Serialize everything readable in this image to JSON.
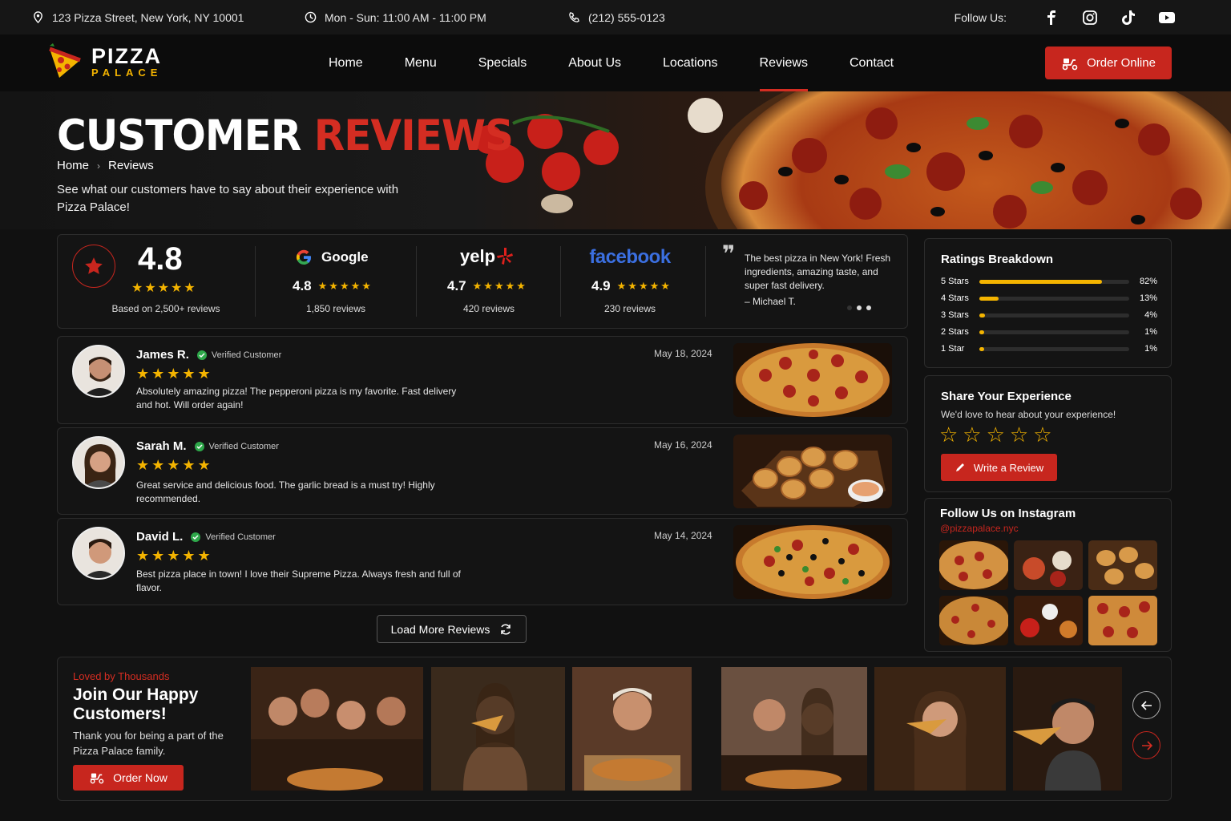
{
  "topbar": {
    "address": "123 Pizza Street, New York, NY 10001",
    "hours": "Mon - Sun: 11:00 AM - 11:00 PM",
    "phone": "(212) 555-0123",
    "follow_label": "Follow Us:",
    "social_icons": [
      "facebook-icon",
      "instagram-icon",
      "tiktok-icon",
      "youtube-icon"
    ]
  },
  "brand": {
    "name_top": "PIZZA",
    "name_bottom": "PALACE"
  },
  "nav": {
    "items": [
      "Home",
      "Menu",
      "Specials",
      "About Us",
      "Locations",
      "Reviews",
      "Contact"
    ],
    "active": "Reviews",
    "order_button": "Order Online"
  },
  "hero": {
    "title_1": "CUSTOMER",
    "title_2": "REVIEWS",
    "breadcrumb_home": "Home",
    "breadcrumb_current": "Reviews",
    "description": "See what our customers have to say about their experience with Pizza Palace!"
  },
  "summary": {
    "overall": "4.8",
    "overall_stars": "★★★★★",
    "overall_sub": "Based on 2,500+ reviews",
    "platforms": [
      {
        "name": "Google",
        "rating": "4.8",
        "stars": "★★★★★",
        "count": "1,850 reviews"
      },
      {
        "name": "yelp",
        "rating": "4.7",
        "stars": "★★★★★",
        "count": "420 reviews"
      },
      {
        "name": "facebook",
        "rating": "4.9",
        "stars": "★★★★★",
        "count": "230 reviews"
      }
    ],
    "quote": "The best pizza in New York! Fresh ingredients, amazing taste, and super fast delivery.",
    "quote_author": "– Michael T."
  },
  "reviews": [
    {
      "name": "James R.",
      "verified": "Verified Customer",
      "date": "May 18, 2024",
      "stars": "★★★★★",
      "text": "Absolutely amazing pizza! The pepperoni pizza is my favorite. Fast delivery and hot. Will order again!"
    },
    {
      "name": "Sarah M.",
      "verified": "Verified Customer",
      "date": "May 16, 2024",
      "stars": "★★★★★",
      "text": "Great service and delicious food. The garlic bread is a must try! Highly recommended."
    },
    {
      "name": "David L.",
      "verified": "Verified Customer",
      "date": "May 14, 2024",
      "stars": "★★★★★",
      "text": "Best pizza place in town! I love their Supreme Pizza. Always fresh and full of flavor."
    }
  ],
  "load_more": "Load More Reviews",
  "breakdown": {
    "title": "Ratings Breakdown",
    "rows": [
      {
        "label": "5 Stars",
        "pct": "82%",
        "value": 0.82
      },
      {
        "label": "4 Stars",
        "pct": "13%",
        "value": 0.13
      },
      {
        "label": "3 Stars",
        "pct": "4%",
        "value": 0.04
      },
      {
        "label": "2 Stars",
        "pct": "1%",
        "value": 0.01
      },
      {
        "label": "1 Star",
        "pct": "1%",
        "value": 0.01
      }
    ]
  },
  "share": {
    "title": "Share Your Experience",
    "subtitle": "We'd love to hear about your experience!",
    "empty_stars": "☆☆☆☆☆",
    "button": "Write a Review"
  },
  "instagram": {
    "title": "Follow Us on Instagram",
    "handle": "@pizzapalace.nyc"
  },
  "customers": {
    "kicker": "Loved by Thousands",
    "title": "Join Our Happy Customers!",
    "text": "Thank you for being a part of the Pizza Palace family.",
    "button": "Order Now"
  },
  "colors": {
    "accent": "#c7261e",
    "star": "#f4b400",
    "background": "#111111"
  }
}
